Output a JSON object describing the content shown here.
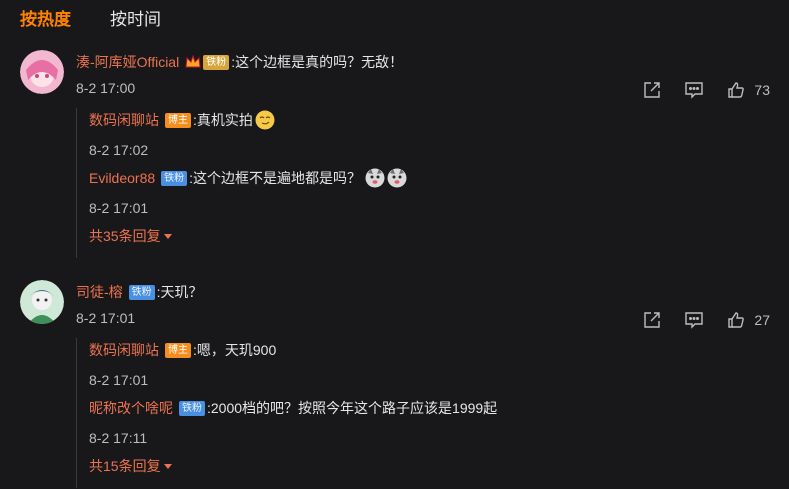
{
  "tabs": {
    "hot": "按热度",
    "time": "按时间"
  },
  "comments": [
    {
      "user": "湊-阿库娅Official",
      "badge": "铁粉",
      "text": ":这个边框是真的吗？无敌！",
      "time": "8-2 17:00",
      "likes": "73",
      "replies": [
        {
          "user": "数码闲聊站",
          "badge": "博主",
          "text": ":真机实拍",
          "time": "8-2 17:02"
        },
        {
          "user": "Evildeor88",
          "badge": "铁粉",
          "text": ":这个边框不是遍地都是吗？",
          "time": "8-2 17:01"
        }
      ],
      "more": "共35条回复"
    },
    {
      "user": "司徒-榕",
      "badge": "铁粉",
      "text": ":天玑？",
      "time": "8-2 17:01",
      "likes": "27",
      "replies": [
        {
          "user": "数码闲聊站",
          "badge": "博主",
          "text": ":嗯，天玑900",
          "time": "8-2 17:01"
        },
        {
          "user": "昵称改个啥呢",
          "badge": "铁粉",
          "text": ":2000档的吧？按照今年这个路子应该是1999起",
          "time": "8-2 17:11"
        }
      ],
      "more": "共15条回复"
    }
  ],
  "colors": {
    "accent": "#ff8200",
    "username": "#eb7350",
    "fan_badge": "#4a90e2",
    "blogger_badge": "#f58e1f"
  }
}
